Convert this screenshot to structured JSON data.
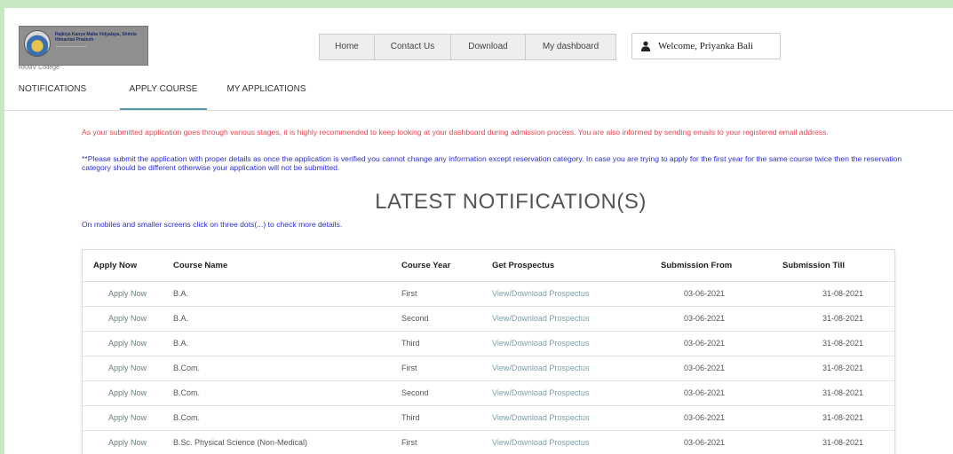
{
  "header": {
    "logo_line1": "Rajkiya Kanya Maha Vidyalaya, Shimla Himachal Pradesh",
    "college_label": "RKMV College",
    "nav": [
      "Home",
      "Contact Us",
      "Download",
      "My dashboard"
    ],
    "welcome": "Welcome,  Priyanka  Bali"
  },
  "tabs": [
    "NOTIFICATIONS",
    "APPLY COURSE",
    "MY APPLICATIONS"
  ],
  "active_tab": "APPLY COURSE",
  "notices": {
    "red": "As your submitted application goes through various stages, it is highly recommended to keep looking at your dashboard during admission process. You are also informed by sending emails to your registered email address.",
    "blue": "**Please submit the application with proper details as once the application is verified you cannot change any information except reservation category. In case you are trying to apply for the first year for the same course twice then the reservation category should be different otherwise your application will not be submitted."
  },
  "heading": "LATEST NOTIFICATION(S)",
  "mobile_hint": "On mobiles and smaller screens click on three dots(...) to check more details.",
  "table": {
    "headers": [
      "Apply Now",
      "Course Name",
      "Course Year",
      "Get Prospectus",
      "Submission From",
      "Submission Till"
    ],
    "rows": [
      [
        "Apply Now",
        "B.A.",
        "First",
        "View/Download Prospectus",
        "03-06-2021",
        "31-08-2021"
      ],
      [
        "Apply Now",
        "B.A.",
        "Second",
        "View/Download Prospectus",
        "03-06-2021",
        "31-08-2021"
      ],
      [
        "Apply Now",
        "B.A.",
        "Third",
        "View/Download Prospectus",
        "03-06-2021",
        "31-08-2021"
      ],
      [
        "Apply Now",
        "B.Com.",
        "First",
        "View/Download Prospectus",
        "03-06-2021",
        "31-08-2021"
      ],
      [
        "Apply Now",
        "B.Com.",
        "Second",
        "View/Download Prospectus",
        "03-06-2021",
        "31-08-2021"
      ],
      [
        "Apply Now",
        "B.Com.",
        "Third",
        "View/Download Prospectus",
        "03-06-2021",
        "31-08-2021"
      ],
      [
        "Apply Now",
        "B.Sc. Physical Science (Non-Medical)",
        "First",
        "View/Download Prospectus",
        "03-06-2021",
        "31-08-2021"
      ]
    ]
  },
  "colors": {
    "frame": "#c8e6c4",
    "notice_red": "#e8454d",
    "notice_blue": "#2a2fd6",
    "tab_underline": "#5a9aa8"
  }
}
